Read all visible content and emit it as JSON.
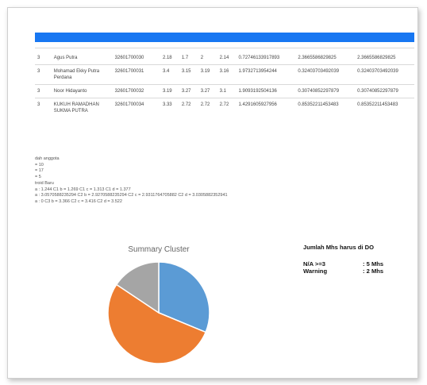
{
  "table": {
    "rows": [
      {
        "no": "3",
        "nama": "Agus Putra",
        "nim": "32601700030",
        "v1": "2.18",
        "v2": "1.7",
        "v3": "2",
        "v4": "2.14",
        "d1": "0.72746133917893",
        "d2": "2.3665586829825",
        "d3": "2.3665586829825"
      },
      {
        "no": "3",
        "nama": "Mohamad Ekky Putra Perdana",
        "nim": "32601700031",
        "v1": "3.4",
        "v2": "3.15",
        "v3": "3.19",
        "v4": "3.16",
        "d1": "1.9732713954244",
        "d2": "0.32403703492039",
        "d3": "0.32403703492039"
      },
      {
        "no": "3",
        "nama": "Noor Hidayanto",
        "nim": "32601700032",
        "v1": "3.19",
        "v2": "3.27",
        "v3": "3.27",
        "v4": "3.1",
        "d1": "1.9093192504136",
        "d2": "0.30740852297879",
        "d3": "0.30740852297879"
      },
      {
        "no": "3",
        "nama": "KUKUH RAMADHAN SUKMA PUTRA",
        "nim": "32601700034",
        "v1": "3.33",
        "v2": "2.72",
        "v3": "2.72",
        "v4": "2.72",
        "d1": "1.4291605927956",
        "d2": "0.85352211453483",
        "d3": "0.85352211453483"
      }
    ]
  },
  "info": {
    "lines": [
      "dah anggota",
      "= 10",
      "= 17",
      "= 5",
      "troid Baru",
      "a : 1.244 C1 b = 1.269 C1 c = 1.313 C1 d = 1.377",
      "a : 3.0570588235294 C2 b = 2.9270588235294 C2 c = 2.9311764705882 C2 d = 3.0305882352941",
      "a : 0 C3 b = 3.366 C2 c = 3.416 C2 d = 3.522"
    ]
  },
  "pie": {
    "title": "Summary Cluster",
    "slices": [
      {
        "value": 10,
        "color": "#5b9bd5"
      },
      {
        "value": 17,
        "color": "#ed7d31"
      },
      {
        "value": 5,
        "color": "#a5a5a5"
      }
    ]
  },
  "do_summary": {
    "title": "Jumlah Mhs harus di DO",
    "rows": [
      {
        "label": "N/A >=3",
        "value": ": 5 Mhs"
      },
      {
        "label": "Warning",
        "value": ": 2 Mhs"
      }
    ]
  }
}
